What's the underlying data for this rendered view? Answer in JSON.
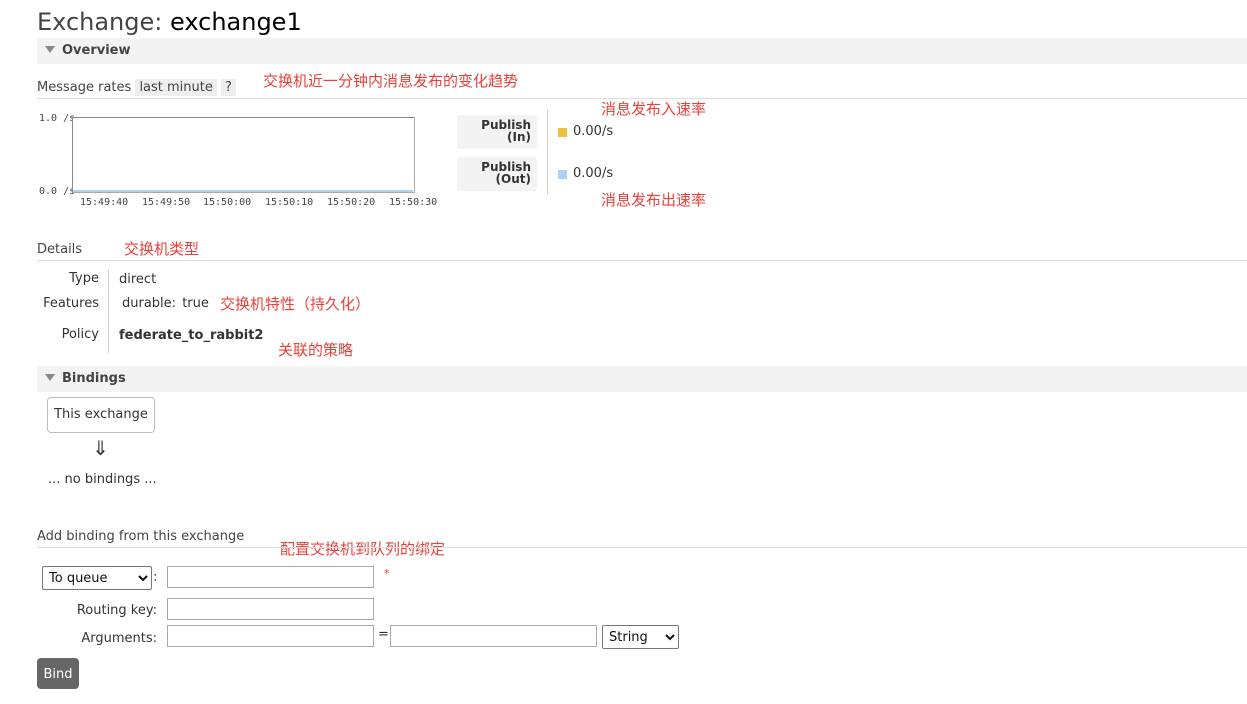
{
  "page": {
    "title_prefix": "Exchange:",
    "exchange_name": "exchange1"
  },
  "overview": {
    "section_title": "Overview",
    "message_rates_label": "Message rates",
    "range_chip": "last minute",
    "help_chip": "?",
    "annotation_trend": "交换机近一分钟内消息发布的变化趋势",
    "chart_data": {
      "type": "line",
      "x": [
        "15:49:40",
        "15:49:50",
        "15:50:00",
        "15:50:10",
        "15:50:20",
        "15:50:30"
      ],
      "ylim": [
        0.0,
        1.0
      ],
      "y_ticks": [
        "1.0 /s",
        "0.0 /s"
      ],
      "series": [
        {
          "name": "Publish (In)",
          "color": "#ebc13d",
          "values": [
            0,
            0,
            0,
            0,
            0,
            0
          ]
        },
        {
          "name": "Publish (Out)",
          "color": "#aad3f0",
          "values": [
            0,
            0,
            0,
            0,
            0,
            0
          ]
        }
      ]
    },
    "legend": {
      "publish_in_line1": "Publish",
      "publish_in_line2": "(In)",
      "publish_in_rate": "0.00/s",
      "publish_in_color": "#ebc13d",
      "publish_out_line1": "Publish",
      "publish_out_line2": "(Out)",
      "publish_out_rate": "0.00/s",
      "publish_out_color": "#aad3f0",
      "annotation_in": "消息发布入速率",
      "annotation_out": "消息发布出速率"
    }
  },
  "details": {
    "heading": "Details",
    "annotation_type": "交换机类型",
    "type_label": "Type",
    "type_value": "direct",
    "features_label": "Features",
    "feature_key": "durable:",
    "feature_value": "true",
    "annotation_features": "交换机特性（持久化）",
    "policy_label": "Policy",
    "policy_value": "federate_to_rabbit2",
    "annotation_policy": "关联的策略"
  },
  "bindings": {
    "section_title": "Bindings",
    "this_exchange": "This exchange",
    "arrow": "⇓",
    "no_bindings": "... no bindings ..."
  },
  "add_binding": {
    "heading": "Add binding from this exchange",
    "annotation": "配置交换机到队列的绑定",
    "destination_select": "To queue",
    "destination_colon": ":",
    "required_mark": "*",
    "routing_key_label": "Routing key:",
    "arguments_label": "Arguments:",
    "equals": "=",
    "arg_type_select": "String",
    "bind_button": "Bind"
  },
  "colors": {
    "annotation": "#e8413a",
    "section_bg": "#f3f3f3",
    "bind_button_bg": "#666666"
  }
}
